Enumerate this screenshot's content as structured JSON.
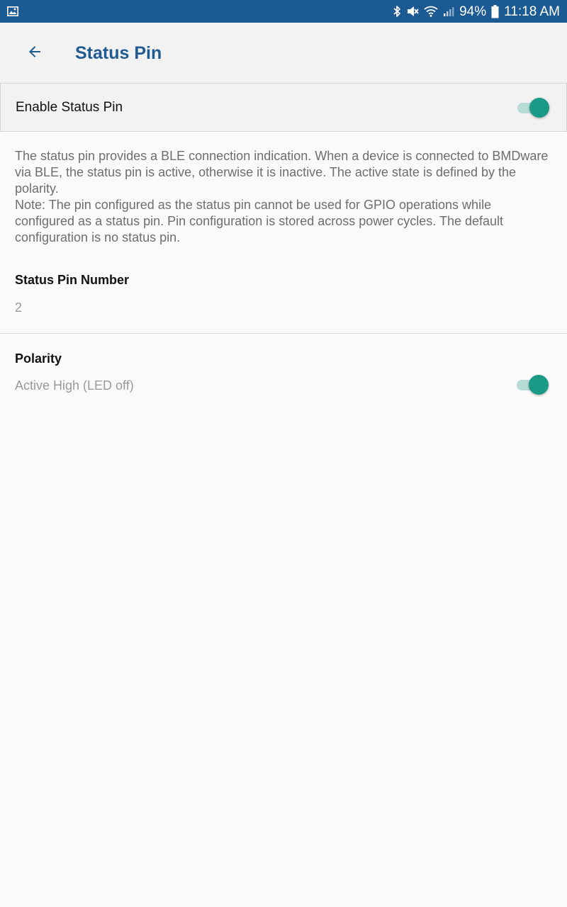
{
  "status_bar": {
    "battery": "94%",
    "time": "11:18 AM",
    "icons": [
      "gallery-icon",
      "bluetooth-icon",
      "mute-icon",
      "wifi-icon",
      "signal-icon",
      "battery-icon"
    ]
  },
  "app_bar": {
    "title": "Status Pin",
    "back_icon": "arrow-back-icon"
  },
  "enable_status_pin": {
    "label": "Enable Status Pin",
    "enabled": true
  },
  "description": {
    "paragraph1": "The status pin provides a BLE connection indication. When a device is connected to BMDware via BLE, the status pin is active, otherwise it is inactive. The active state is defined by the polarity.",
    "paragraph2": "Note: The pin configured as the status pin cannot be used for GPIO operations while configured as a status pin. Pin configuration is stored across power cycles. The default configuration is no status pin."
  },
  "status_pin_number": {
    "title": "Status Pin Number",
    "value": "2"
  },
  "polarity": {
    "title": "Polarity",
    "value": "Active High (LED off)",
    "enabled": true
  },
  "colors": {
    "status_bar": "#1c5a94",
    "accent": "#1a9a86",
    "title": "#1f5b91"
  }
}
